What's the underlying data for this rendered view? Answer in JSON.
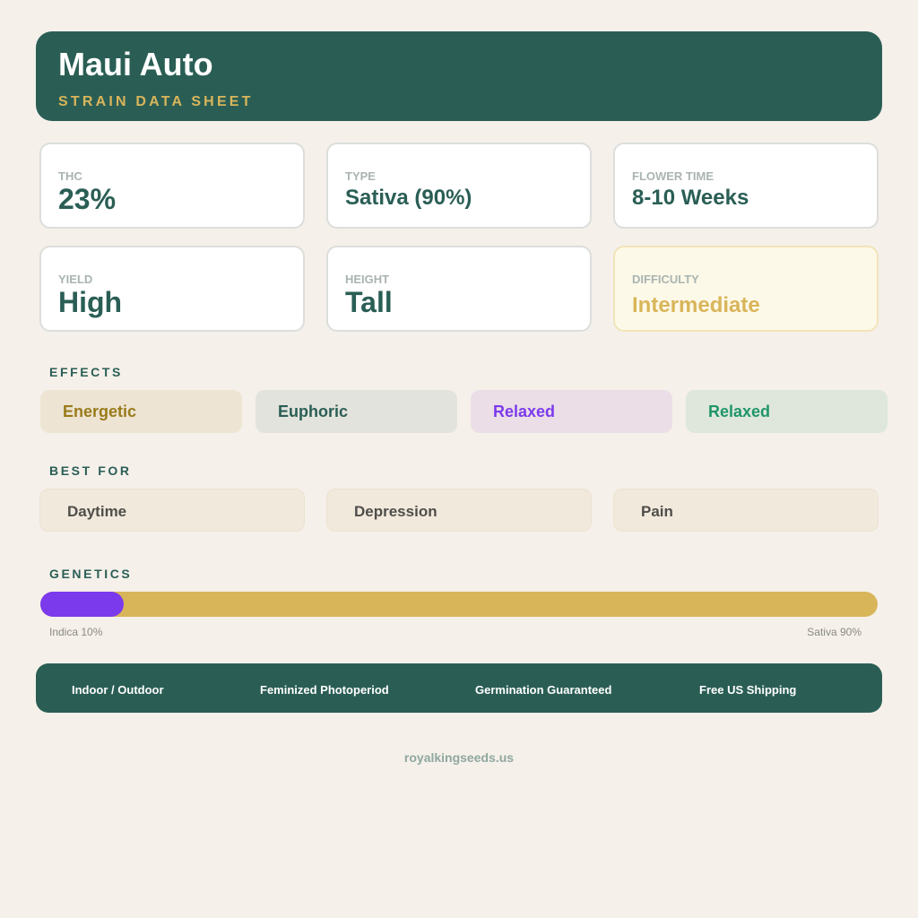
{
  "header": {
    "title": "Maui Auto",
    "subtitle": "STRAIN DATA SHEET"
  },
  "stats": [
    {
      "label": "THC",
      "value": "23%"
    },
    {
      "label": "TYPE",
      "value": "Sativa (90%)"
    },
    {
      "label": "FLOWER TIME",
      "value": "8-10 Weeks"
    },
    {
      "label": "YIELD",
      "value": "High"
    },
    {
      "label": "HEIGHT",
      "value": "Tall"
    },
    {
      "label": "DIFFICULTY",
      "value": "Intermediate"
    }
  ],
  "effects": {
    "label": "EFFECTS",
    "items": [
      "Energetic",
      "Euphoric",
      "Relaxed",
      "Relaxed"
    ]
  },
  "best_for": {
    "label": "BEST FOR",
    "items": [
      "Daytime",
      "Depression",
      "Pain"
    ]
  },
  "genetics": {
    "label": "GENETICS",
    "indica_percent": 10,
    "sativa_percent": 90,
    "indica_caption": "Indica 10%",
    "sativa_caption": "Sativa 90%"
  },
  "features": [
    "Indoor / Outdoor",
    "Feminized Photoperiod",
    "Germination Guaranteed",
    "Free US Shipping"
  ],
  "footer": {
    "site": "royalkingseeds.us"
  },
  "colors": {
    "brand": "#2a5e55",
    "accent_gold": "#d9b55a",
    "indica": "#7c3aed",
    "background": "#f5f0ea"
  }
}
